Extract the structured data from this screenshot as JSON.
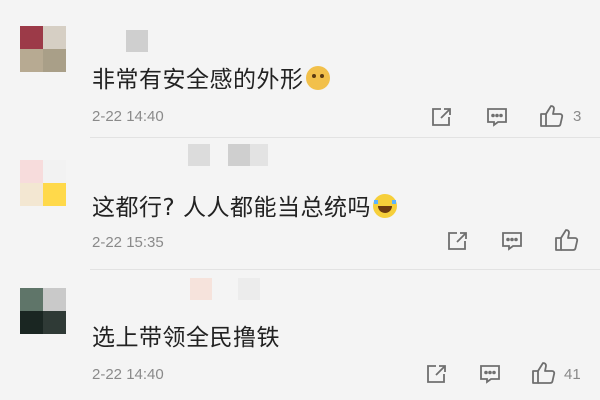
{
  "comments": [
    {
      "text": "非常有安全感的外形",
      "emoji": "doge-emoji",
      "time": "2-22 14:40",
      "likes": "3"
    },
    {
      "text": "这都行? 人人都能当总统吗",
      "emoji": "laughing-crying-emoji",
      "time": "2-22 15:35",
      "likes": ""
    },
    {
      "text": "选上带领全民撸铁",
      "emoji": "",
      "time": "2-22 14:40",
      "likes": "41"
    }
  ],
  "icons": {
    "forward": "share-icon",
    "reply": "comment-icon",
    "like": "thumbs-up-icon"
  },
  "colors": {
    "background": "#f4f4f4",
    "text": "#222222",
    "meta": "#8a8a8a"
  }
}
